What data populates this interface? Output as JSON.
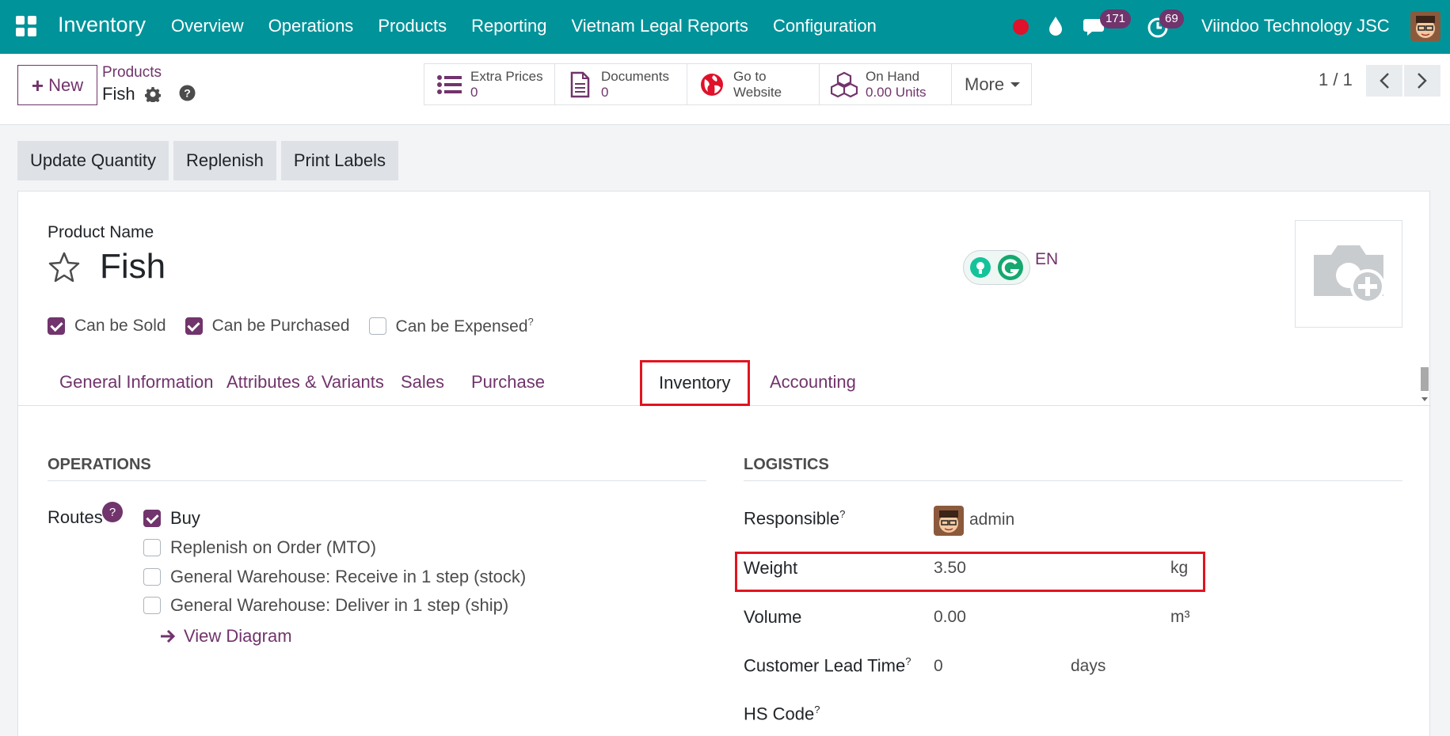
{
  "navbar": {
    "app_name": "Inventory",
    "menu": [
      "Overview",
      "Operations",
      "Products",
      "Reporting",
      "Vietnam Legal Reports",
      "Configuration"
    ],
    "chat_count": "171",
    "activity_count": "69",
    "company": "Viindoo Technology JSC"
  },
  "control": {
    "new_label": "New",
    "breadcrumb_parent": "Products",
    "breadcrumb_current": "Fish",
    "smart_buttons": [
      {
        "label": "Extra Prices",
        "value": "0",
        "icon": "list-icon"
      },
      {
        "label": "Documents",
        "value": "0",
        "icon": "document-icon"
      },
      {
        "label": "Go to",
        "value": "Website",
        "icon": "globe-icon"
      },
      {
        "label": "On Hand",
        "value": "0.00 Units",
        "icon": "cubes-icon"
      }
    ],
    "more_label": "More",
    "pager": "1 / 1"
  },
  "actions": [
    "Update Quantity",
    "Replenish",
    "Print Labels"
  ],
  "form": {
    "product_name_label": "Product Name",
    "product_name": "Fish",
    "lang": "EN",
    "checks": [
      {
        "label": "Can be Sold",
        "checked": true,
        "help": ""
      },
      {
        "label": "Can be Purchased",
        "checked": true,
        "help": ""
      },
      {
        "label": "Can be Expensed",
        "checked": false,
        "help": "?"
      }
    ],
    "tabs": [
      "General Information",
      "Attributes & Variants",
      "Sales",
      "Purchase",
      "Inventory",
      "Accounting"
    ],
    "active_tab": "Inventory",
    "operations": {
      "title": "OPERATIONS",
      "routes_label": "Routes",
      "routes_help": "?",
      "routes": [
        {
          "label": "Buy",
          "checked": true
        },
        {
          "label": "Replenish on Order (MTO)",
          "checked": false
        },
        {
          "label": "General Warehouse: Receive in 1 step (stock)",
          "checked": false
        },
        {
          "label": "General Warehouse: Deliver in 1 step (ship)",
          "checked": false
        }
      ],
      "view_diagram": "View Diagram"
    },
    "logistics": {
      "title": "LOGISTICS",
      "responsible_label": "Responsible",
      "responsible_value": "admin",
      "weight_label": "Weight",
      "weight_value": "3.50",
      "weight_unit": "kg",
      "volume_label": "Volume",
      "volume_value": "0.00",
      "volume_unit": "m³",
      "lead_time_label": "Customer Lead Time",
      "lead_time_value": "0",
      "lead_time_unit": "days",
      "hs_code_label": "HS Code",
      "help": "?"
    }
  },
  "colors": {
    "navbar": "#00939a",
    "accent": "#71346c",
    "highlight": "#e1141f"
  }
}
